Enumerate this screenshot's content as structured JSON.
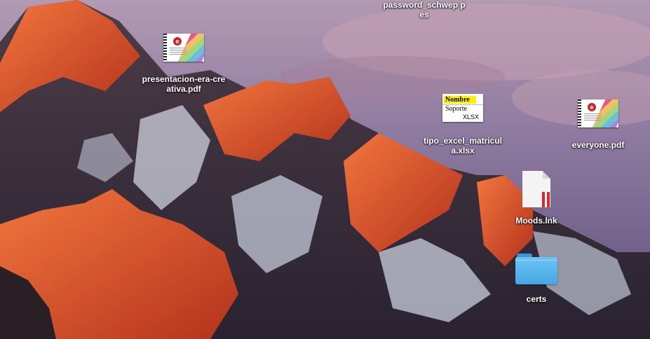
{
  "desktop": {
    "wallpaper": "sierra-mountain-sunset",
    "icons": [
      {
        "label": "password_schwep pes",
        "kind": "file",
        "icon": "file-icon"
      },
      {
        "label": "presentacion-era-creativa.pdf",
        "kind": "pdf",
        "icon": "pdf-icon"
      },
      {
        "label": "tipo_excel_matricula.xlsx",
        "kind": "xlsx",
        "icon": "spreadsheet-icon",
        "preview": {
          "line1": "Nombre",
          "line2": "Soporte",
          "line3": "XLSX"
        }
      },
      {
        "label": "everyone.pdf",
        "kind": "pdf",
        "icon": "pdf-icon"
      },
      {
        "label": "Moods.lnk",
        "kind": "lnk",
        "icon": "shortcut-document-icon"
      },
      {
        "label": "certs",
        "kind": "folder",
        "icon": "folder-icon"
      }
    ]
  },
  "colors": {
    "sky_top": "#c2a1b4",
    "sky_bottom": "#6c5a8a",
    "mountain_lit": "#e8582c",
    "folder_blue": "#5ab6ee",
    "badge_red": "#d7282f"
  }
}
